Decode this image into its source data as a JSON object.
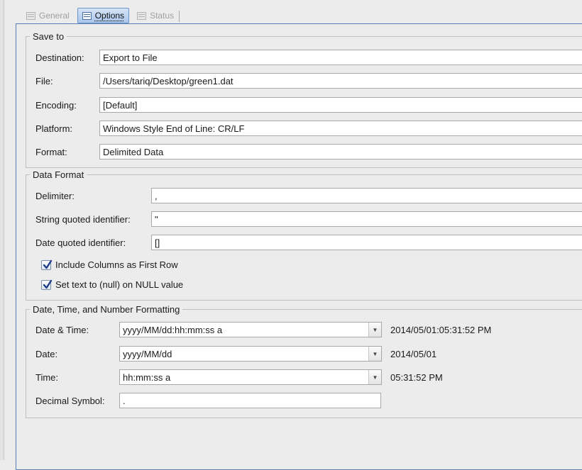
{
  "tabs": [
    {
      "label": "General",
      "icon": "table-icon",
      "active": false
    },
    {
      "label": "Options",
      "icon": "table-icon",
      "active": true
    },
    {
      "label": "Status",
      "icon": "table-icon",
      "active": false
    }
  ],
  "save_to": {
    "title": "Save to",
    "destination": {
      "label": "Destination:",
      "value": "Export to File"
    },
    "file": {
      "label": "File:",
      "value": "/Users/tariq/Desktop/green1.dat"
    },
    "encoding": {
      "label": "Encoding:",
      "value": "[Default]"
    },
    "platform": {
      "label": "Platform:",
      "value": "Windows Style End of Line: CR/LF"
    },
    "format": {
      "label": "Format:",
      "value": "Delimited Data"
    }
  },
  "data_format": {
    "title": "Data Format",
    "delimiter": {
      "label": "Delimiter:",
      "value": ","
    },
    "string_quoted": {
      "label": "String quoted identifier:",
      "value": "\""
    },
    "date_quoted": {
      "label": "Date quoted identifier:",
      "value": "[]"
    },
    "include_columns": {
      "label": "Include Columns as First Row",
      "checked": true
    },
    "set_null": {
      "label": "Set text to (null) on NULL value",
      "checked": true
    }
  },
  "formatting": {
    "title": "Date, Time, and Number Formatting",
    "datetime": {
      "label": "Date & Time:",
      "value": "yyyy/MM/dd:hh:mm:ss a",
      "preview": "2014/05/01:05:31:52 PM"
    },
    "date": {
      "label": "Date:",
      "value": "yyyy/MM/dd",
      "preview": "2014/05/01"
    },
    "time": {
      "label": "Time:",
      "value": "hh:mm:ss a",
      "preview": "05:31:52 PM"
    },
    "decimal": {
      "label": "Decimal Symbol:",
      "value": "."
    }
  },
  "colors": {
    "accent_border": "#5a7fb7",
    "tab_active": "#a9c6ea"
  }
}
